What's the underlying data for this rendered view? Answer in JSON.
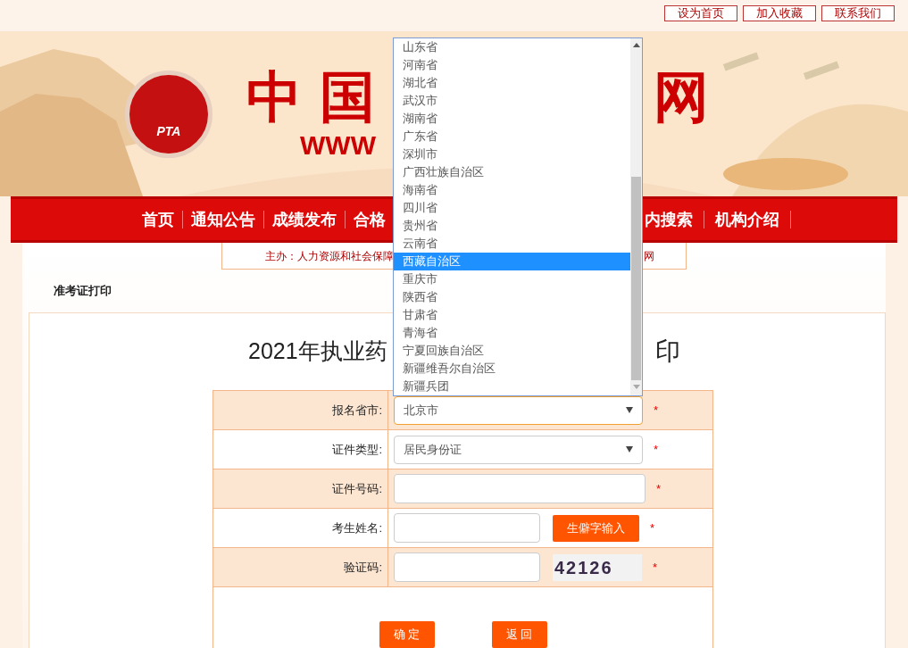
{
  "top_links": [
    "设为首页",
    "加入收藏",
    "联系我们"
  ],
  "banner": {
    "logo": "PTA",
    "title_left": "中国",
    "title_right": "网",
    "url": "WWW"
  },
  "nav_left": [
    "首页",
    "通知公告",
    "成绩发布",
    "合格"
  ],
  "nav_right": [
    "内搜索",
    "机构介绍"
  ],
  "sponsor": {
    "left": "主办：人力资源和社会保障",
    "right": "网"
  },
  "breadcrumb": "准考证打印",
  "page_title": {
    "left": "2021年执业药",
    "right": "印"
  },
  "form": {
    "rows": [
      {
        "kind": "select",
        "label": "报名省市:",
        "value": "北京市",
        "expanded": true,
        "required": "*"
      },
      {
        "kind": "select",
        "label": "证件类型:",
        "value": "居民身份证",
        "expanded": false,
        "required": "*"
      },
      {
        "kind": "input",
        "label": "证件号码:",
        "required": "*"
      },
      {
        "kind": "input_button",
        "label": "考生姓名:",
        "button": "生僻字输入",
        "required": "*"
      },
      {
        "kind": "captcha",
        "label": "验证码:",
        "captcha": "42126",
        "required": "*"
      }
    ],
    "buttons": [
      "确 定",
      "返 回"
    ]
  },
  "dropdown": [
    {
      "label": "山东省",
      "selected": false
    },
    {
      "label": "河南省",
      "selected": false
    },
    {
      "label": "湖北省",
      "selected": false
    },
    {
      "label": "武汉市",
      "selected": false
    },
    {
      "label": "湖南省",
      "selected": false
    },
    {
      "label": "广东省",
      "selected": false
    },
    {
      "label": "深圳市",
      "selected": false
    },
    {
      "label": "广西壮族自治区",
      "selected": false
    },
    {
      "label": "海南省",
      "selected": false
    },
    {
      "label": "四川省",
      "selected": false
    },
    {
      "label": "贵州省",
      "selected": false
    },
    {
      "label": "云南省",
      "selected": false
    },
    {
      "label": "西藏自治区",
      "selected": true
    },
    {
      "label": "重庆市",
      "selected": false
    },
    {
      "label": "陕西省",
      "selected": false
    },
    {
      "label": "甘肃省",
      "selected": false
    },
    {
      "label": "青海省",
      "selected": false
    },
    {
      "label": "宁夏回族自治区",
      "selected": false
    },
    {
      "label": "新疆维吾尔自治区",
      "selected": false
    },
    {
      "label": "新疆兵团",
      "selected": false
    }
  ]
}
